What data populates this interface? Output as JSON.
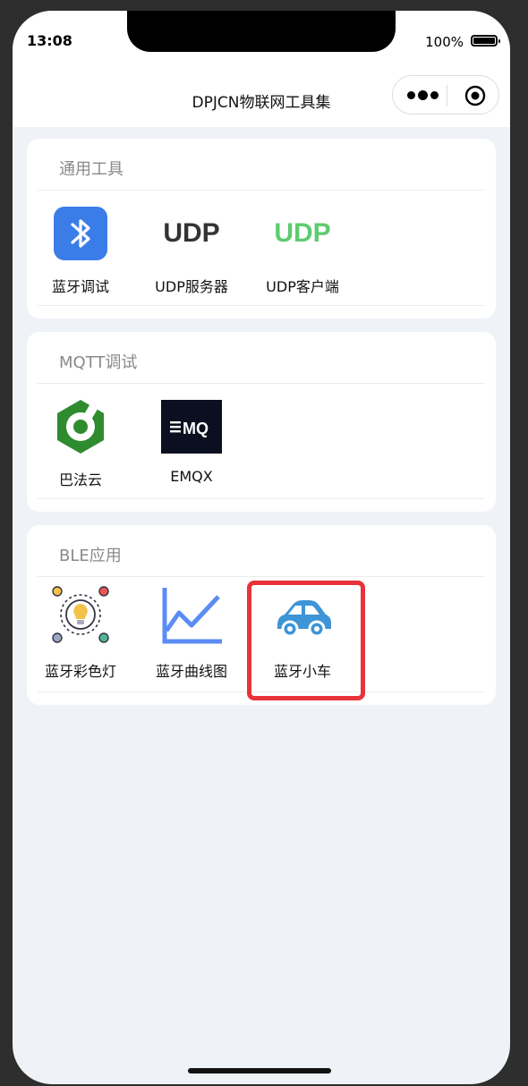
{
  "status": {
    "time": "13:08",
    "battery": "100%"
  },
  "nav": {
    "title": "DPJCN物联网工具集"
  },
  "sections": [
    {
      "title": "通用工具",
      "items": [
        {
          "label": "蓝牙调试",
          "icon": "bluetooth-icon"
        },
        {
          "label": "UDP服务器",
          "icon": "udp-server-icon",
          "icon_text": "UDP"
        },
        {
          "label": "UDP客户端",
          "icon": "udp-client-icon",
          "icon_text": "UDP"
        }
      ]
    },
    {
      "title": "MQTT调试",
      "items": [
        {
          "label": "巴法云",
          "icon": "bafayun-logo-icon"
        },
        {
          "label": "EMQX",
          "icon": "emqx-logo-icon",
          "icon_text": "MQ"
        }
      ]
    },
    {
      "title": "BLE应用",
      "items": [
        {
          "label": "蓝牙彩色灯",
          "icon": "color-light-icon"
        },
        {
          "label": "蓝牙曲线图",
          "icon": "line-chart-icon"
        },
        {
          "label": "蓝牙小车",
          "icon": "car-icon"
        }
      ]
    }
  ],
  "colors": {
    "bluetooth": "#3b7de8",
    "udp_server": "#333333",
    "udp_client": "#5ecb6f",
    "bafayun": "#2e8b2e",
    "emqx_bg": "#0b1020",
    "chart": "#5b8cf5",
    "car": "#3d94d6",
    "highlight": "#e8333a"
  }
}
